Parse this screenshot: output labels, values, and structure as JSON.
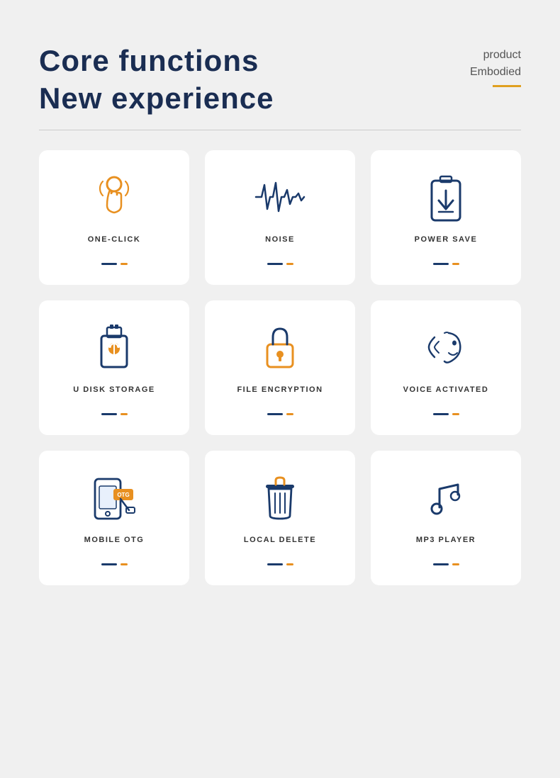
{
  "header": {
    "title_line1": "Core functions",
    "title_line2": "New experience",
    "product_line1": "product",
    "product_line2": "Embodied"
  },
  "cards": [
    {
      "id": "one-click",
      "label": "ONE-CLICK",
      "icon": "touch"
    },
    {
      "id": "noise",
      "label": "NOISE",
      "icon": "waveform"
    },
    {
      "id": "power-save",
      "label": "POWER SAVE",
      "icon": "battery"
    },
    {
      "id": "u-disk-storage",
      "label": "U DISK STORAGE",
      "icon": "usb"
    },
    {
      "id": "file-encryption",
      "label": "FILE ENCRYPTION",
      "icon": "lock"
    },
    {
      "id": "voice-activated",
      "label": "VOICE ACTIVATED",
      "icon": "voice"
    },
    {
      "id": "mobile-otg",
      "label": "MOBILE OTG",
      "icon": "otg"
    },
    {
      "id": "local-delete",
      "label": "LOCAL DELETE",
      "icon": "trash"
    },
    {
      "id": "mp3-player",
      "label": "MP3 PLAYER",
      "icon": "music"
    }
  ]
}
